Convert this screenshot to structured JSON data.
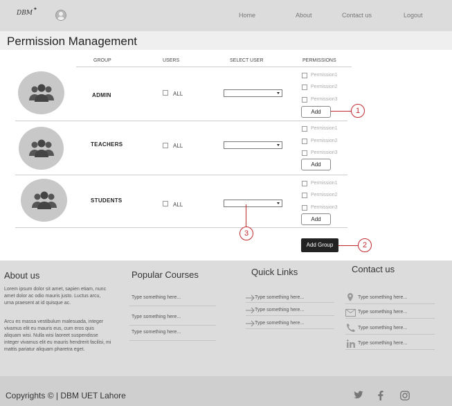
{
  "header": {
    "logo": "DBM",
    "logo_star": "✦",
    "nav": [
      "Home",
      "About",
      "Contact us",
      "Logout"
    ]
  },
  "page_title": "Permission Management",
  "table": {
    "headers": [
      "GROUP",
      "USERS",
      "SELECT USER",
      "PERMISSIONS"
    ],
    "all_label": "ALL",
    "add_label": "Add",
    "permissions": [
      "Permission1",
      "Permission2",
      "Permission3"
    ],
    "groups": [
      "ADMIN",
      "TEACHERS",
      "STUDENTS"
    ]
  },
  "add_group_label": "Add Group",
  "callouts": [
    "1",
    "2",
    "3"
  ],
  "footer": {
    "about": {
      "title": "About us",
      "para1": "Lorem ipsum dolor sit amet, sapien etiam, nunc amet dolor ac odio mauris justo. Luctus arcu, urna praesent at id quisque ac.",
      "para2": "Arcu es massa vestibulum malesuada, integer vivamus elit eu mauris eus, cum eros quis aliquam wisi. Nulla wisi laoreet suspendisse integer vivamus elit eu mauris hendrerit facilisi, mi mattis pariatur aliquam pharetra eget."
    },
    "courses": {
      "title": "Popular Courses",
      "items": [
        "Type something here...",
        "Type something here...",
        "Type something here..."
      ]
    },
    "links": {
      "title": "Quick Links",
      "items": [
        "Type something here...",
        "Type something here...",
        "Type something here..."
      ]
    },
    "contact": {
      "title": "Contact us",
      "items": [
        "Type something here...",
        "Type something here...",
        "Type something here...",
        "Type something here..."
      ]
    }
  },
  "copyright": "Copyrights © | DBM UET Lahore",
  "colors": {
    "header_bg": "#dcdcdc",
    "footer_bg": "#dcdcdc",
    "callout": "#c0272d",
    "button_dark": "#222222"
  }
}
